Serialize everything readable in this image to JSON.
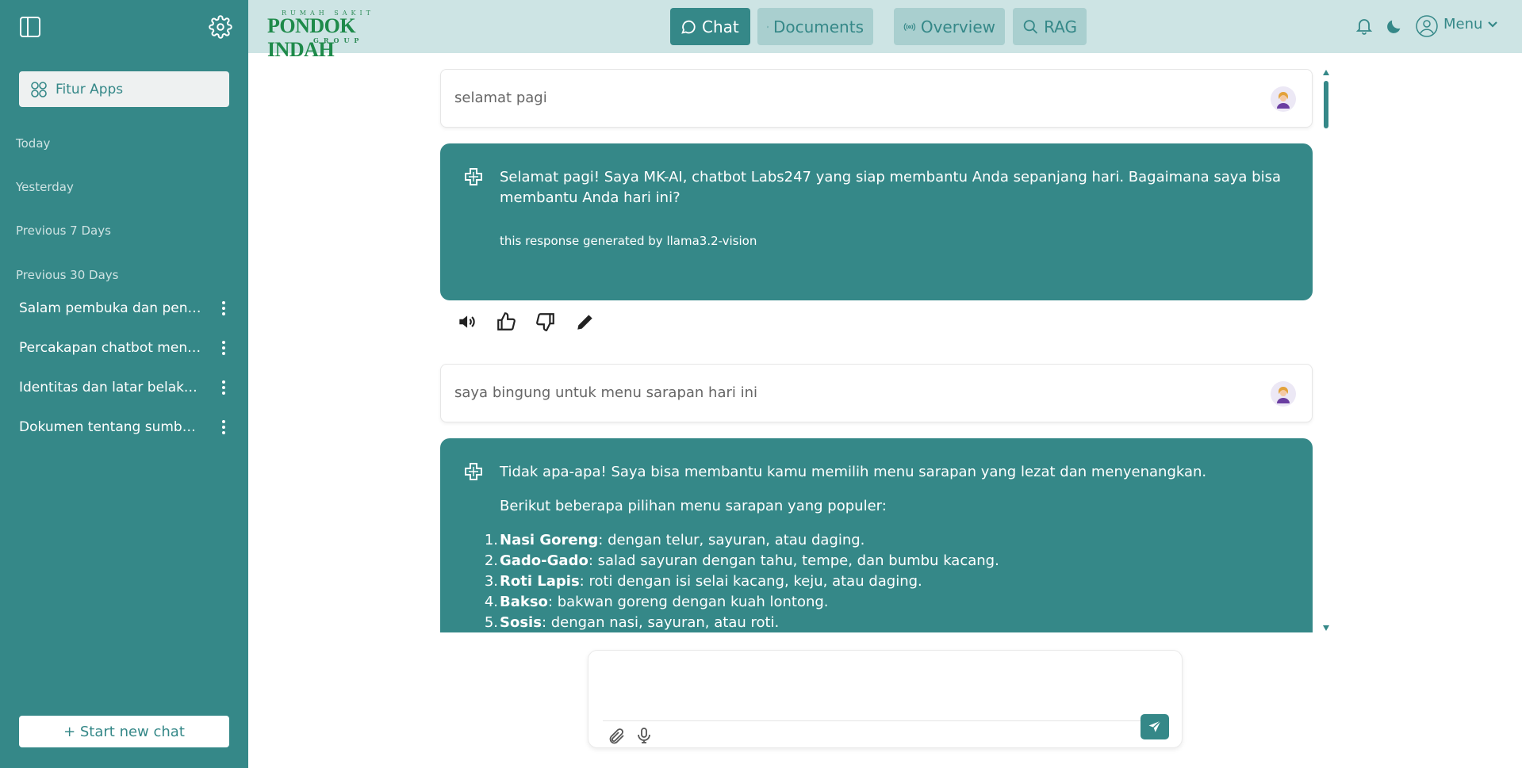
{
  "sidebar": {
    "fitur_apps_label": "Fitur Apps",
    "sections": [
      "Today",
      "Yesterday",
      "Previous 7 Days",
      "Previous 30 Days"
    ],
    "items": [
      {
        "label": "Salam pembuka dan penawaran bantuan"
      },
      {
        "label": "Percakapan chatbot menyambut pengguna"
      },
      {
        "label": "Identitas dan latar belakang chatbot"
      },
      {
        "label": "Dokumen tentang sumber informasi"
      }
    ],
    "new_chat_label": "+ Start new chat"
  },
  "header": {
    "logo_top": "RUMAH SAKIT",
    "logo_main": "PONDOK INDAH",
    "logo_bottom": "GROUP",
    "nav": {
      "chat": "Chat",
      "documents": "Documents",
      "overview": "Overview",
      "rag": "RAG"
    },
    "menu_label": "Menu"
  },
  "messages": {
    "user1": "selamat pagi",
    "bot1": {
      "text": "Selamat pagi! Saya MK-AI, chatbot Labs247 yang siap membantu Anda sepanjang hari. Bagaimana saya bisa membantu Anda hari ini?",
      "note": "this response generated by llama3.2-vision"
    },
    "user2": "saya bingung untuk menu sarapan hari ini",
    "bot2": {
      "intro": "Tidak apa-apa! Saya bisa membantu kamu memilih menu sarapan yang lezat dan menyenangkan.",
      "p2": "Berikut beberapa pilihan menu sarapan yang populer:",
      "list": [
        {
          "num": "1.",
          "bold": "Nasi Goreng",
          "rest": ": dengan telur, sayuran, atau daging."
        },
        {
          "num": "2.",
          "bold": "Gado-Gado",
          "rest": ": salad sayuran dengan tahu, tempe, dan bumbu kacang."
        },
        {
          "num": "3.",
          "bold": "Roti Lapis",
          "rest": ": roti dengan isi selai kacang, keju, atau daging."
        },
        {
          "num": "4.",
          "bold": "Bakso",
          "rest": ": bakwan goreng dengan kuah lontong."
        },
        {
          "num": "5.",
          "bold": "Sosis",
          "rest": ": dengan nasi, sayuran, atau roti."
        }
      ]
    }
  },
  "composer": {
    "placeholder": ""
  },
  "colors": {
    "primary": "#358888",
    "header_bg": "#cde4e4",
    "nav_inactive_bg": "#a9cfcf"
  }
}
